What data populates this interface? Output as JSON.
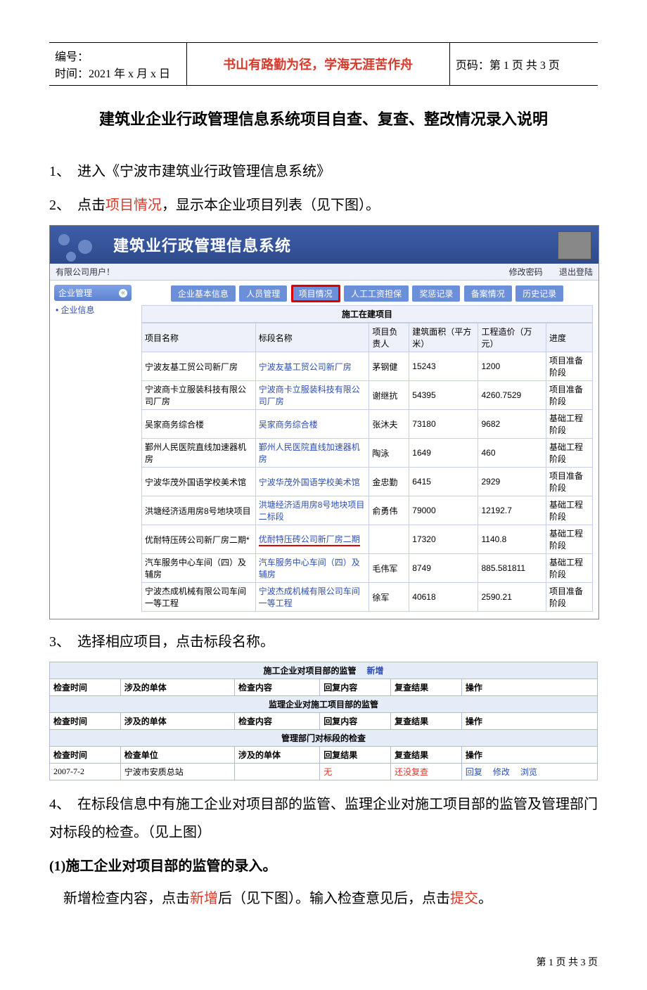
{
  "header": {
    "id_label": "编号：",
    "time_label": "时间：2021 年 x 月 x 日",
    "motto": "书山有路勤为径，学海无涯苦作舟",
    "page_label": "页码：第 1 页 共 3 页"
  },
  "title": "建筑业企业行政管理信息系统项目自查、复查、整改情况录入说明",
  "items": {
    "i1": "1、　进入《宁波市建筑业行政管理信息系统》",
    "i2a": "2、　点击",
    "i2b": "项目情况",
    "i2c": "，显示本企业项目列表（见下图）。",
    "i3": "3、　选择相应项目，点击标段名称。",
    "i4": "4、　在标段信息中有施工企业对项目部的监管、监理企业对施工项目部的监管及管理部门对标段的检查。（见上图）",
    "sub1": "(1)施工企业对项目部的监管的录入。",
    "sub1a": "　新增检查内容，点击",
    "sub1b": "新增",
    "sub1c": "后（见下图）。输入检查意见后，点击",
    "sub1d": "提交",
    "sub1e": "。"
  },
  "shot1": {
    "banner_title": "建筑业行政管理信息系统",
    "user_left": "有限公司用户！",
    "user_link1": "修改密码",
    "user_link2": "退出登陆",
    "side_head": "企业管理",
    "side_item": "• 企业信息",
    "tabs": [
      "企业基本信息",
      "人员管理",
      "项目情况",
      "人工工资担保",
      "奖惩记录",
      "备案情况",
      "历史记录"
    ],
    "table_title": "施工在建项目",
    "cols": [
      "项目名称",
      "标段名称",
      "项目负责人",
      "建筑面积（平方米）",
      "工程造价（万元）",
      "进度"
    ],
    "rows": [
      {
        "c0": "宁波友基工贸公司新厂房",
        "c1": "宁波友基工贸公司新厂房",
        "c2": "茅钢健",
        "c3": "15243",
        "c4": "1200",
        "c5": "项目准备阶段"
      },
      {
        "c0": "宁波商卡立服装科技有限公司厂房",
        "c1": "宁波商卡立服装科技有限公司厂房",
        "c2": "谢继抗",
        "c3": "54395",
        "c4": "4260.7529",
        "c5": "项目准备阶段"
      },
      {
        "c0": "吴家商务综合楼",
        "c1": "吴家商务综合楼",
        "c2": "张沐夫",
        "c3": "73180",
        "c4": "9682",
        "c5": "基础工程阶段"
      },
      {
        "c0": "鄞州人民医院直线加速器机房",
        "c1": "鄞州人民医院直线加速器机房",
        "c2": "陶泳",
        "c3": "1649",
        "c4": "460",
        "c5": "基础工程阶段"
      },
      {
        "c0": "宁波华茂外国语学校美术馆",
        "c1": "宁波华茂外国语学校美术馆",
        "c2": "金忠勤",
        "c3": "6415",
        "c4": "2929",
        "c5": "项目准备阶段"
      },
      {
        "c0": "洪塘经济适用房8号地块项目",
        "c1": "洪塘经济适用房8号地块项目二标段",
        "c2": "俞勇伟",
        "c3": "79000",
        "c4": "12192.7",
        "c5": "基础工程阶段"
      },
      {
        "c0": "优耐特压砖公司新厂房二期*",
        "c1": "优耐特压砖公司新厂房二期",
        "c2": "",
        "c3": "17320",
        "c4": "1140.8",
        "c5": "基础工程阶段",
        "hl": true
      },
      {
        "c0": "汽车服务中心车间（四）及辅房",
        "c1": "汽车服务中心车间（四）及辅房",
        "c2": "毛伟军",
        "c3": "8749",
        "c4": "885.581811",
        "c5": "基础工程阶段"
      },
      {
        "c0": "宁波杰成机械有限公司车间一等工程",
        "c1": "宁波杰成机械有限公司车间一等工程",
        "c2": "徐军",
        "c3": "40618",
        "c4": "2590.21",
        "c5": "项目准备阶段"
      }
    ]
  },
  "shot2": {
    "sec1": "施工企业对项目部的监管",
    "sec1_add": "新增",
    "cols1": [
      "检查时间",
      "涉及的单体",
      "检查内容",
      "回复内容",
      "复查结果",
      "操作"
    ],
    "sec2": "监理企业对施工项目部的监管",
    "sec3": "管理部门对标段的检查",
    "cols3": [
      "检查时间",
      "检查单位",
      "涉及的单体",
      "回复结果",
      "复查结果",
      "操作"
    ],
    "row3": {
      "c0": "2007-7-2",
      "c1": "宁波市安质总站",
      "c2": "",
      "c3": "无",
      "c4": "还没复查",
      "c5a": "回复",
      "c5b": "修改",
      "c5c": "浏览"
    }
  },
  "footer": "第 1 页 共 3 页"
}
